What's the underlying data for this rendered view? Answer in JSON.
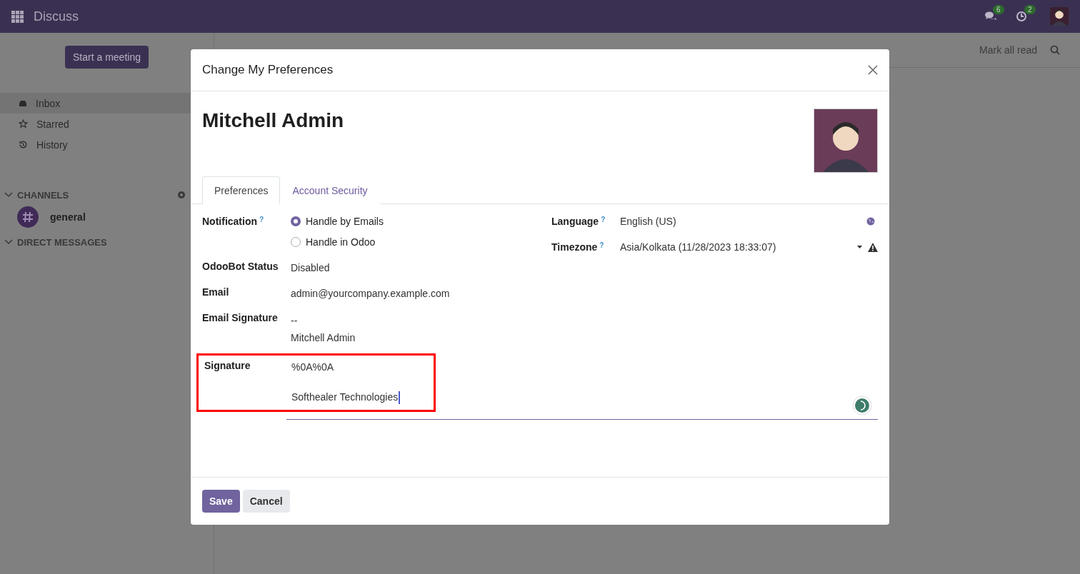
{
  "navbar": {
    "app_title": "Discuss",
    "badges": [
      {
        "kind": "chat",
        "count": "6"
      },
      {
        "kind": "activity",
        "count": "2"
      }
    ]
  },
  "sidebar": {
    "button": "Start a meeting",
    "items": [
      {
        "kind": "inbox",
        "label": "Inbox",
        "selected": true
      },
      {
        "kind": "starred",
        "label": "Starred",
        "selected": false
      },
      {
        "kind": "history",
        "label": "History",
        "selected": false
      }
    ],
    "sections": [
      {
        "title": "CHANNELS",
        "expanded": true,
        "channels": [
          {
            "name": "general"
          }
        ]
      },
      {
        "title": "DIRECT MESSAGES",
        "expanded": true
      }
    ]
  },
  "header": {
    "action": "Mark all read"
  },
  "dialog": {
    "title": "Change My Preferences",
    "name": "Mitchell Admin",
    "tabs": [
      {
        "label": "Preferences",
        "selected": true
      },
      {
        "label": "Account Security",
        "selected": false
      }
    ],
    "left_fields": [
      {
        "kind": "radio",
        "label": "Notification",
        "help": "?",
        "options": [
          {
            "label": "Handle by Emails",
            "selected": true
          },
          {
            "label": "Handle in Odoo",
            "selected": false
          }
        ]
      },
      {
        "kind": "text",
        "label": "OdooBot Status",
        "value": "Disabled"
      },
      {
        "kind": "text",
        "label": "Email",
        "value": "admin@yourcompany.example.com"
      },
      {
        "kind": "multiline",
        "label": "Email Signature",
        "lines": [
          "--",
          "Mitchell Admin"
        ]
      }
    ],
    "right_fields": [
      {
        "kind": "language",
        "label": "Language",
        "help": "?",
        "value": "English (US)"
      },
      {
        "kind": "timezone",
        "label": "Timezone",
        "help": "?",
        "value": "Asia/Kolkata (11/28/2023 18:33:07)"
      }
    ],
    "signature": {
      "label": "Signature",
      "highlighted": true,
      "lines": [
        "%0A%0A",
        "Softhealer Technologies"
      ]
    },
    "buttons": [
      {
        "kind": "primary",
        "label": "Save"
      },
      {
        "kind": "secondary",
        "label": "Cancel"
      }
    ]
  }
}
